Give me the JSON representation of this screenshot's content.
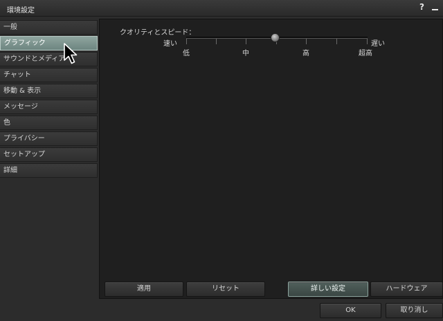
{
  "window": {
    "title": "環境設定"
  },
  "titlebar": {
    "help_glyph": "?"
  },
  "sidebar": {
    "items": [
      {
        "label": "一般"
      },
      {
        "label": "グラフィック",
        "selected": true
      },
      {
        "label": "サウンドとメディア"
      },
      {
        "label": "チャット"
      },
      {
        "label": "移動 & 表示"
      },
      {
        "label": "メッセージ"
      },
      {
        "label": "色"
      },
      {
        "label": "プライバシー"
      },
      {
        "label": "セットアップ"
      },
      {
        "label": "詳細"
      }
    ]
  },
  "graphics": {
    "quality_label": "クオリティとスピード：",
    "slider": {
      "left_label": "速い",
      "right_label": "遅い",
      "ticks": [
        "低",
        "中",
        "高",
        "超高"
      ],
      "value_fraction": 0.48
    }
  },
  "panel_buttons": {
    "apply": "適用",
    "reset": "リセット",
    "advanced": "詳しい設定",
    "hardware": "ハードウェア"
  },
  "dialog_buttons": {
    "ok": "OK",
    "cancel": "取り消し"
  },
  "colors": {
    "selected_item": "#7f9691",
    "highlight_border": "#8da49e"
  }
}
